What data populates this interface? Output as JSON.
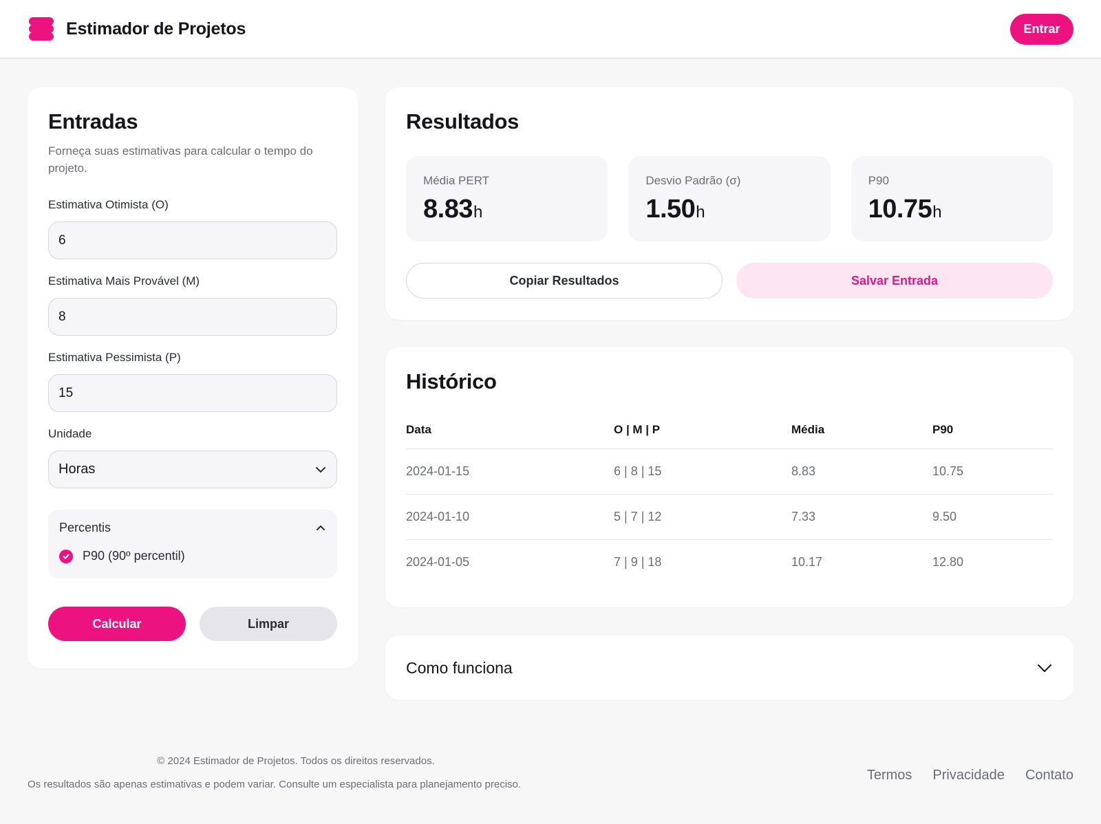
{
  "header": {
    "logo_icon": "stack-icon",
    "title": "Estimador de Projetos",
    "login_label": "Entrar"
  },
  "inputs": {
    "title": "Entradas",
    "subtitle": "Forneça suas estimativas para calcular o tempo do projeto.",
    "optimistic": {
      "label": "Estimativa Otimista (O)",
      "value": "6"
    },
    "most_likely": {
      "label": "Estimativa Mais Provável (M)",
      "value": "8"
    },
    "pessimistic": {
      "label": "Estimativa Pessimista (P)",
      "value": "15"
    },
    "unit": {
      "label": "Unidade",
      "selected": "Horas"
    },
    "percentiles": {
      "label": "Percentis",
      "option_label": "P90 (90º percentil)",
      "checked": true
    },
    "calculate_label": "Calcular",
    "clear_label": "Limpar"
  },
  "results": {
    "title": "Resultados",
    "stats": [
      {
        "label": "Média PERT",
        "value": "8.83",
        "unit": "h"
      },
      {
        "label": "Desvio Padrão (σ)",
        "value": "1.50",
        "unit": "h"
      },
      {
        "label": "P90",
        "value": "10.75",
        "unit": "h"
      }
    ],
    "copy_label": "Copiar Resultados",
    "save_label": "Salvar Entrada"
  },
  "history": {
    "title": "Histórico",
    "columns": [
      "Data",
      "O | M | P",
      "Média",
      "P90"
    ],
    "rows": [
      [
        "2024-01-15",
        "6 | 8 | 15",
        "8.83",
        "10.75"
      ],
      [
        "2024-01-10",
        "5 | 7 | 12",
        "7.33",
        "9.50"
      ],
      [
        "2024-01-05",
        "7 | 9 | 18",
        "10.17",
        "12.80"
      ]
    ]
  },
  "how_it_works": {
    "title": "Como funciona"
  },
  "footer": {
    "copyright": "© 2024 Estimador de Projetos. Todos os direitos reservados.",
    "disclaimer": "Os resultados são apenas estimativas e podem variar. Consulte um especialista para planejamento preciso.",
    "links": [
      "Termos",
      "Privacidade",
      "Contato"
    ]
  },
  "colors": {
    "accent": "#ec1280",
    "accent_soft": "#fde5f1",
    "background": "#f8f7f8",
    "text_primary": "#15161b",
    "text_muted": "#6b6d78"
  }
}
